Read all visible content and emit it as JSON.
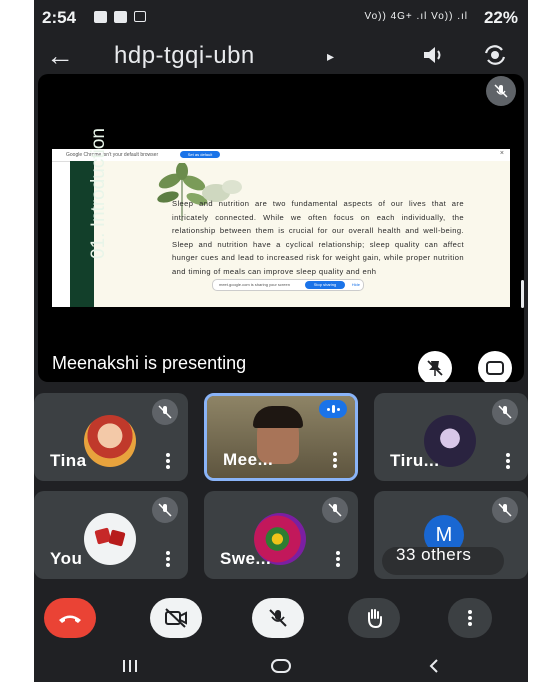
{
  "status_bar": {
    "time": "2:54",
    "signal_text": "Vo)) 4G+ .ıl Vo)) .ıl",
    "battery": "22%"
  },
  "header": {
    "meeting_code": "hdp-tgqi-ubn",
    "caret": "▸"
  },
  "presentation": {
    "browser_banner": "Google Chrome isn't your default browser",
    "set_default_button": "Set as default",
    "slide_title": "01. Introduction",
    "slide_text": "Sleep and nutrition are two fundamental aspects of our lives that are intricately connected. While we often focus on each individually, the relationship between them is crucial for our overall health and well-being. Sleep and nutrition have a cyclical relationship; sleep quality can affect hunger cues and lead to increased risk for weight gain, while proper nutrition and timing of meals can improve sleep quality and enh",
    "find_bar_text": "meet.google.com is sharing your screen",
    "stop_sharing_button": "Stop sharing",
    "hide_button": "Hide",
    "presenting_label": "Meenakshi is presenting"
  },
  "participants": [
    {
      "name": "Tina"
    },
    {
      "name": "Mee..."
    },
    {
      "name": "Tiru..."
    },
    {
      "name": "You"
    },
    {
      "name": "Swe..."
    },
    {
      "name": "33 others",
      "avatar_letter": "M"
    }
  ],
  "colors": {
    "background": "#202124",
    "tile": "#3c4043",
    "end_call": "#ea4335",
    "active_border": "#8ab4f8"
  },
  "icons": [
    "back-arrow-icon",
    "speaker-icon",
    "switch-camera-icon",
    "mic-off-icon",
    "unpin-icon",
    "fullscreen-icon",
    "end-call-icon",
    "camera-off-icon",
    "raise-hand-icon",
    "more-options-icon"
  ]
}
